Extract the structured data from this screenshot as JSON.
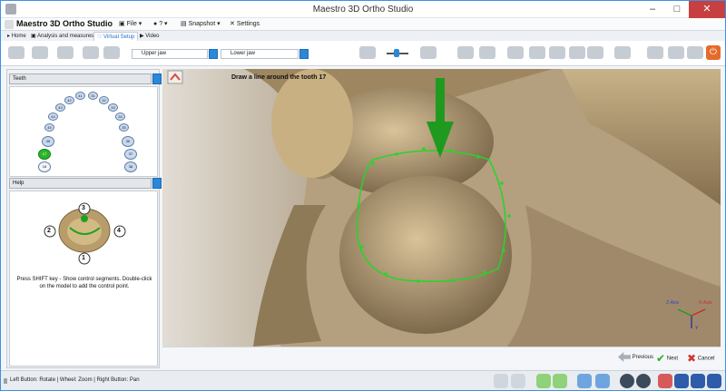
{
  "window": {
    "title": "Maestro 3D Ortho Studio",
    "minimize": "–",
    "maximize": "□",
    "close": "✕"
  },
  "toolbar": {
    "brand": "Maestro 3D Ortho Studio",
    "file": "File",
    "help": "?",
    "snapshot": "Snapshot",
    "settings": "Settings"
  },
  "tabs": [
    {
      "label": "Home"
    },
    {
      "label": "Analysis and measures"
    },
    {
      "label": "Virtual Setup"
    },
    {
      "label": "Video"
    }
  ],
  "ribbon": {
    "upper_jaw": "Upper jaw",
    "lower_jaw": "Lower jaw"
  },
  "sidebar": {
    "teeth_title": "Teeth",
    "help_title": "Help",
    "teeth": [
      {
        "num": "41",
        "sel": false
      },
      {
        "num": "31",
        "sel": false
      },
      {
        "num": "42",
        "sel": false
      },
      {
        "num": "32",
        "sel": false
      },
      {
        "num": "43",
        "sel": false
      },
      {
        "num": "33",
        "sel": false
      },
      {
        "num": "44",
        "sel": false
      },
      {
        "num": "34",
        "sel": false
      },
      {
        "num": "45",
        "sel": false
      },
      {
        "num": "35",
        "sel": false
      },
      {
        "num": "46",
        "sel": false
      },
      {
        "num": "36",
        "sel": false
      },
      {
        "num": "17",
        "sel": true
      },
      {
        "num": "37",
        "sel": false
      },
      {
        "num": "18",
        "sel": false
      },
      {
        "num": "38",
        "sel": false
      }
    ],
    "help_labels": [
      "1",
      "2",
      "3",
      "4"
    ],
    "help_text": "Press SHIFT key - Show control segments. Double-click on the model to add the control point."
  },
  "viewport": {
    "instruction": "Draw a line around the tooth 17",
    "axis_labels": {
      "z": "Z-Axis",
      "x": "X-Axis",
      "y": "Y"
    }
  },
  "navigation": {
    "previous": "Previous",
    "next": "Next",
    "cancel": "Cancel"
  },
  "status": "Left Button: Rotate | Wheel: Zoom | Right Button: Pan",
  "colors": {
    "accent": "#2b88d8",
    "selection": "#2ab82a",
    "arrow": "#1f9a1f",
    "model": "#a58e6c"
  }
}
